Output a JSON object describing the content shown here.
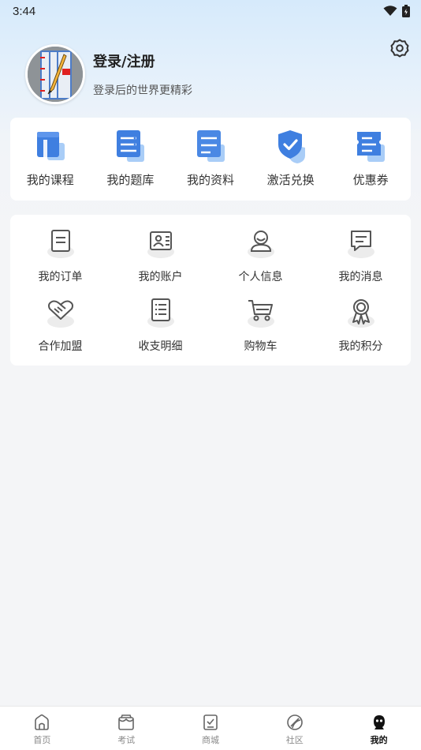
{
  "status": {
    "time": "3:44"
  },
  "profile": {
    "title": "登录/注册",
    "subtitle": "登录后的世界更精彩"
  },
  "quick_links": [
    {
      "label": "我的课程",
      "icon": "course-icon"
    },
    {
      "label": "我的题库",
      "icon": "question-bank-icon"
    },
    {
      "label": "我的资料",
      "icon": "materials-icon"
    },
    {
      "label": "激活兑换",
      "icon": "activate-icon"
    },
    {
      "label": "优惠券",
      "icon": "coupon-icon"
    }
  ],
  "services": [
    {
      "label": "我的订单",
      "icon": "order-icon"
    },
    {
      "label": "我的账户",
      "icon": "account-icon"
    },
    {
      "label": "个人信息",
      "icon": "person-icon"
    },
    {
      "label": "我的消息",
      "icon": "message-icon"
    },
    {
      "label": "合作加盟",
      "icon": "handshake-icon"
    },
    {
      "label": "收支明细",
      "icon": "ledger-icon"
    },
    {
      "label": "购物车",
      "icon": "cart-icon"
    },
    {
      "label": "我的积分",
      "icon": "medal-icon"
    }
  ],
  "tabs": [
    {
      "label": "首页",
      "icon": "home-icon",
      "active": false
    },
    {
      "label": "考试",
      "icon": "exam-icon",
      "active": false
    },
    {
      "label": "商城",
      "icon": "shop-icon",
      "active": false
    },
    {
      "label": "社区",
      "icon": "community-icon",
      "active": false
    },
    {
      "label": "我的",
      "icon": "mine-icon",
      "active": true
    }
  ],
  "colors": {
    "accent_blue": "#3f7fe0",
    "light_blue": "#6aaaf5",
    "icon_gray": "#555555"
  }
}
